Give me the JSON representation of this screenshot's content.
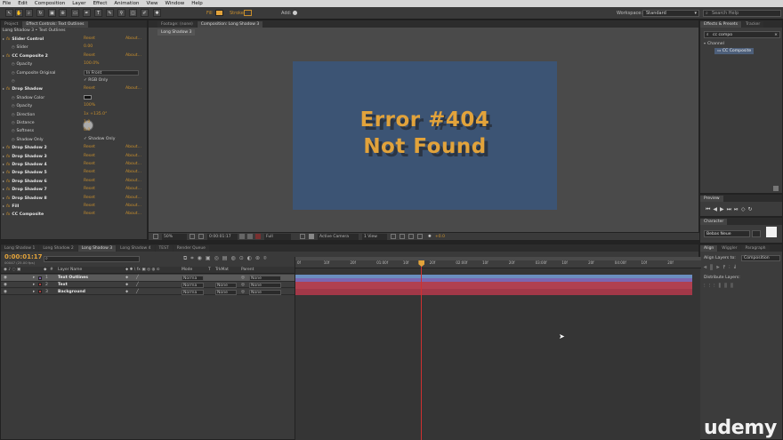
{
  "menu": [
    "File",
    "Edit",
    "Composition",
    "Layer",
    "Effect",
    "Animation",
    "View",
    "Window",
    "Help"
  ],
  "toolbar": {
    "fill_label": "Fill",
    "stroke_label": "Stroke",
    "add_label": "Add:",
    "workspace_label": "Workspace:",
    "workspace_value": "Standard",
    "search_placeholder": "Search Help"
  },
  "left_tabs": [
    "Project",
    "Effect Controls: Text Outlines"
  ],
  "effect_controls": {
    "header": "Long Shadow 3 • Text Outlines",
    "rows": [
      {
        "name": "Slider Control",
        "kind": "effect",
        "reset": "Reset",
        "about": "About..."
      },
      {
        "name": "Slider",
        "kind": "prop",
        "value": "0.00"
      },
      {
        "name": "CC Composite 2",
        "kind": "effect",
        "reset": "Reset",
        "about": "About..."
      },
      {
        "name": "Opacity",
        "kind": "prop",
        "value": "100.0%"
      },
      {
        "name": "Composite Original",
        "kind": "prop",
        "value": "In Front"
      },
      {
        "name": "",
        "kind": "prop",
        "value": "RGB Only"
      },
      {
        "name": "Drop Shadow",
        "kind": "effect",
        "reset": "Reset",
        "about": "About..."
      },
      {
        "name": "Shadow Color",
        "kind": "prop",
        "value": ""
      },
      {
        "name": "Opacity",
        "kind": "prop",
        "value": "100%"
      },
      {
        "name": "Direction",
        "kind": "prop",
        "value": "1x +135.0°"
      },
      {
        "name": "Distance",
        "kind": "prop",
        "value": "1.0"
      },
      {
        "name": "Softness",
        "kind": "prop",
        "value": "0.0"
      },
      {
        "name": "Shadow Only",
        "kind": "prop",
        "value": "Shadow Only"
      },
      {
        "name": "Drop Shadow 2",
        "kind": "effect",
        "reset": "Reset",
        "about": "About..."
      },
      {
        "name": "Drop Shadow 3",
        "kind": "effect",
        "reset": "Reset",
        "about": "About..."
      },
      {
        "name": "Drop Shadow 4",
        "kind": "effect",
        "reset": "Reset",
        "about": "About..."
      },
      {
        "name": "Drop Shadow 5",
        "kind": "effect",
        "reset": "Reset",
        "about": "About..."
      },
      {
        "name": "Drop Shadow 6",
        "kind": "effect",
        "reset": "Reset",
        "about": "About..."
      },
      {
        "name": "Drop Shadow 7",
        "kind": "effect",
        "reset": "Reset",
        "about": "About..."
      },
      {
        "name": "Drop Shadow 8",
        "kind": "effect",
        "reset": "Reset",
        "about": "About..."
      },
      {
        "name": "Fill",
        "kind": "effect",
        "reset": "Reset",
        "about": "About..."
      },
      {
        "name": "CC Composite",
        "kind": "effect",
        "reset": "Reset",
        "about": "About..."
      }
    ]
  },
  "comp_tabs": [
    "Footage: (none)",
    "Composition: Long Shadow 3"
  ],
  "comp_subtab": "Long Shadow 3",
  "canvas": {
    "line1": "Error #404",
    "line2": "Not Found",
    "bg": "#3c5474",
    "text_color": "#e2a33b"
  },
  "viewer_footer": {
    "zoom": "50%",
    "time": "0:00:01:17",
    "quality": "Full",
    "camera": "Active Camera",
    "views": "1 View",
    "exposure": "+0.0"
  },
  "right": {
    "effects_tab": "Effects & Presets",
    "tracker_tab": "Tracker",
    "search_value": "cc compo",
    "category": "Channel",
    "item": "CC Composite",
    "preview_tab": "Preview",
    "character_tab": "Character",
    "font": "Bebas Neue",
    "align_tabs": [
      "Align",
      "Wiggler",
      "Paragraph"
    ],
    "align_label": "Align Layers to:",
    "align_value": "Composition",
    "distribute_label": "Distribute Layers:"
  },
  "timeline_tabs": [
    "Long Shadow 1",
    "Long Shadow 2",
    "Long Shadow 3",
    "Long Shadow 4",
    "TEST",
    "Render Queue"
  ],
  "timeline": {
    "timecode": "0:00:01:17",
    "frames": "00047 (25.00 fps)",
    "col_layer": "Layer Name",
    "col_mode": "Mode",
    "col_trk": "TrkMat",
    "col_parent": "Parent",
    "layers": [
      {
        "num": "1",
        "name": "Text Outlines",
        "mode": "Norma",
        "trk": "",
        "parent": "None",
        "color": "#7a5ea8"
      },
      {
        "num": "2",
        "name": "Text",
        "mode": "Norma",
        "trk": "None",
        "parent": "None",
        "color": "#b04040"
      },
      {
        "num": "3",
        "name": "Background",
        "mode": "Norma",
        "trk": "None",
        "parent": "None",
        "color": "#b04040"
      }
    ],
    "ruler": [
      "0f",
      "10f",
      "20f",
      "01:00f",
      "10f",
      "20f",
      "02:00f",
      "10f",
      "20f",
      "03:00f",
      "10f",
      "20f",
      "04:00f",
      "10f",
      "20f"
    ],
    "playhead_fraction": 0.31
  },
  "watermark": "udemy"
}
